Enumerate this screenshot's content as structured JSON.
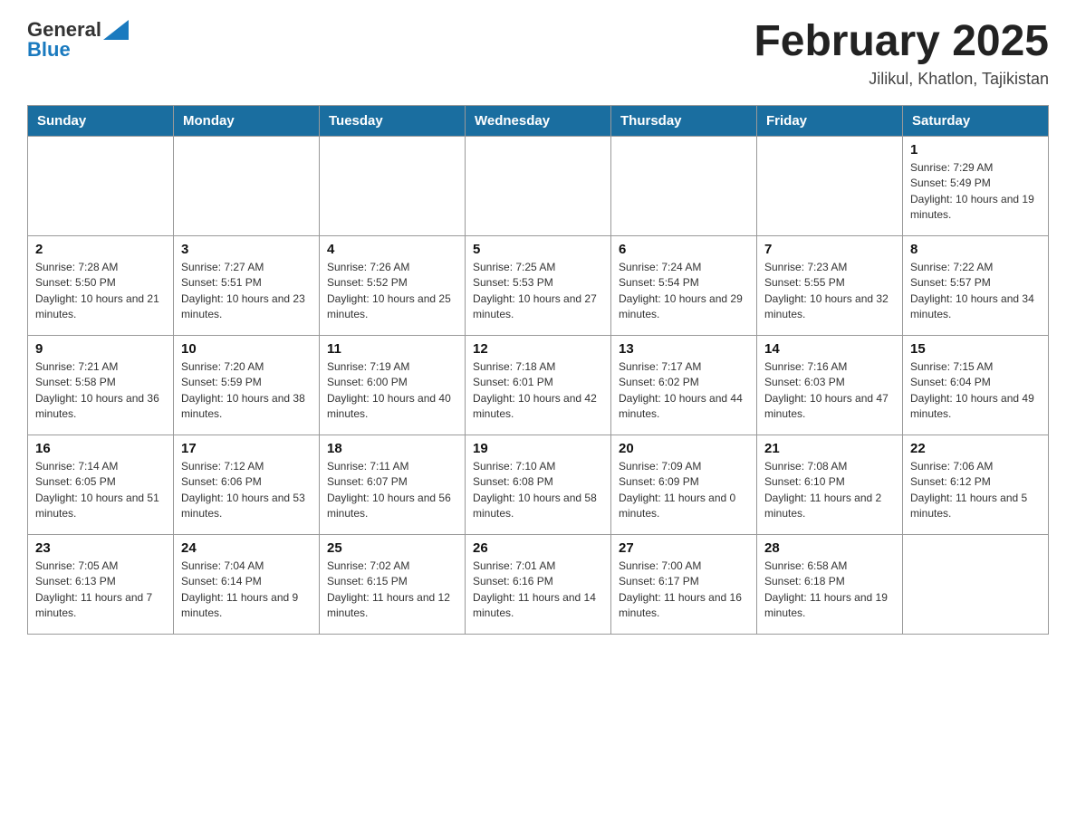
{
  "header": {
    "logo_general": "General",
    "logo_blue": "Blue",
    "month_title": "February 2025",
    "location": "Jilikul, Khatlon, Tajikistan"
  },
  "weekdays": [
    "Sunday",
    "Monday",
    "Tuesday",
    "Wednesday",
    "Thursday",
    "Friday",
    "Saturday"
  ],
  "weeks": [
    [
      {
        "day": "",
        "info": ""
      },
      {
        "day": "",
        "info": ""
      },
      {
        "day": "",
        "info": ""
      },
      {
        "day": "",
        "info": ""
      },
      {
        "day": "",
        "info": ""
      },
      {
        "day": "",
        "info": ""
      },
      {
        "day": "1",
        "info": "Sunrise: 7:29 AM\nSunset: 5:49 PM\nDaylight: 10 hours and 19 minutes."
      }
    ],
    [
      {
        "day": "2",
        "info": "Sunrise: 7:28 AM\nSunset: 5:50 PM\nDaylight: 10 hours and 21 minutes."
      },
      {
        "day": "3",
        "info": "Sunrise: 7:27 AM\nSunset: 5:51 PM\nDaylight: 10 hours and 23 minutes."
      },
      {
        "day": "4",
        "info": "Sunrise: 7:26 AM\nSunset: 5:52 PM\nDaylight: 10 hours and 25 minutes."
      },
      {
        "day": "5",
        "info": "Sunrise: 7:25 AM\nSunset: 5:53 PM\nDaylight: 10 hours and 27 minutes."
      },
      {
        "day": "6",
        "info": "Sunrise: 7:24 AM\nSunset: 5:54 PM\nDaylight: 10 hours and 29 minutes."
      },
      {
        "day": "7",
        "info": "Sunrise: 7:23 AM\nSunset: 5:55 PM\nDaylight: 10 hours and 32 minutes."
      },
      {
        "day": "8",
        "info": "Sunrise: 7:22 AM\nSunset: 5:57 PM\nDaylight: 10 hours and 34 minutes."
      }
    ],
    [
      {
        "day": "9",
        "info": "Sunrise: 7:21 AM\nSunset: 5:58 PM\nDaylight: 10 hours and 36 minutes."
      },
      {
        "day": "10",
        "info": "Sunrise: 7:20 AM\nSunset: 5:59 PM\nDaylight: 10 hours and 38 minutes."
      },
      {
        "day": "11",
        "info": "Sunrise: 7:19 AM\nSunset: 6:00 PM\nDaylight: 10 hours and 40 minutes."
      },
      {
        "day": "12",
        "info": "Sunrise: 7:18 AM\nSunset: 6:01 PM\nDaylight: 10 hours and 42 minutes."
      },
      {
        "day": "13",
        "info": "Sunrise: 7:17 AM\nSunset: 6:02 PM\nDaylight: 10 hours and 44 minutes."
      },
      {
        "day": "14",
        "info": "Sunrise: 7:16 AM\nSunset: 6:03 PM\nDaylight: 10 hours and 47 minutes."
      },
      {
        "day": "15",
        "info": "Sunrise: 7:15 AM\nSunset: 6:04 PM\nDaylight: 10 hours and 49 minutes."
      }
    ],
    [
      {
        "day": "16",
        "info": "Sunrise: 7:14 AM\nSunset: 6:05 PM\nDaylight: 10 hours and 51 minutes."
      },
      {
        "day": "17",
        "info": "Sunrise: 7:12 AM\nSunset: 6:06 PM\nDaylight: 10 hours and 53 minutes."
      },
      {
        "day": "18",
        "info": "Sunrise: 7:11 AM\nSunset: 6:07 PM\nDaylight: 10 hours and 56 minutes."
      },
      {
        "day": "19",
        "info": "Sunrise: 7:10 AM\nSunset: 6:08 PM\nDaylight: 10 hours and 58 minutes."
      },
      {
        "day": "20",
        "info": "Sunrise: 7:09 AM\nSunset: 6:09 PM\nDaylight: 11 hours and 0 minutes."
      },
      {
        "day": "21",
        "info": "Sunrise: 7:08 AM\nSunset: 6:10 PM\nDaylight: 11 hours and 2 minutes."
      },
      {
        "day": "22",
        "info": "Sunrise: 7:06 AM\nSunset: 6:12 PM\nDaylight: 11 hours and 5 minutes."
      }
    ],
    [
      {
        "day": "23",
        "info": "Sunrise: 7:05 AM\nSunset: 6:13 PM\nDaylight: 11 hours and 7 minutes."
      },
      {
        "day": "24",
        "info": "Sunrise: 7:04 AM\nSunset: 6:14 PM\nDaylight: 11 hours and 9 minutes."
      },
      {
        "day": "25",
        "info": "Sunrise: 7:02 AM\nSunset: 6:15 PM\nDaylight: 11 hours and 12 minutes."
      },
      {
        "day": "26",
        "info": "Sunrise: 7:01 AM\nSunset: 6:16 PM\nDaylight: 11 hours and 14 minutes."
      },
      {
        "day": "27",
        "info": "Sunrise: 7:00 AM\nSunset: 6:17 PM\nDaylight: 11 hours and 16 minutes."
      },
      {
        "day": "28",
        "info": "Sunrise: 6:58 AM\nSunset: 6:18 PM\nDaylight: 11 hours and 19 minutes."
      },
      {
        "day": "",
        "info": ""
      }
    ]
  ]
}
